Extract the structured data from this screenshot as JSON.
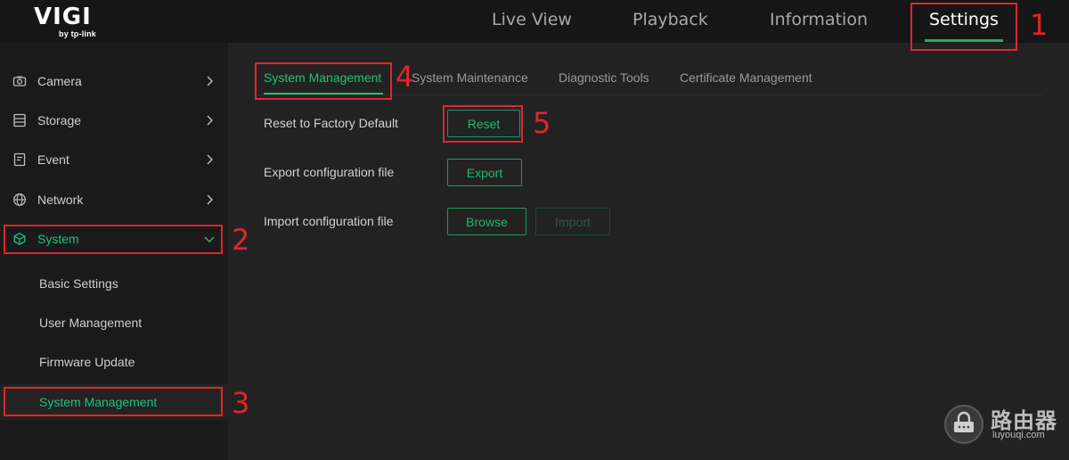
{
  "logo": {
    "main": "VIGI",
    "sub": "by tp-link"
  },
  "topnav": [
    {
      "label": "Live View"
    },
    {
      "label": "Playback"
    },
    {
      "label": "Information"
    },
    {
      "label": "Settings",
      "active": true
    }
  ],
  "sidebar": {
    "items": [
      {
        "label": "Camera",
        "icon": "camera-icon"
      },
      {
        "label": "Storage",
        "icon": "storage-icon"
      },
      {
        "label": "Event",
        "icon": "event-icon"
      },
      {
        "label": "Network",
        "icon": "globe-icon"
      },
      {
        "label": "System",
        "icon": "cube-icon",
        "active": true,
        "expanded": true
      }
    ],
    "subitems": [
      {
        "label": "Basic Settings"
      },
      {
        "label": "User Management"
      },
      {
        "label": "Firmware Update"
      },
      {
        "label": "System Management",
        "active": true
      }
    ]
  },
  "tabs": [
    {
      "label": "System Management",
      "active": true
    },
    {
      "label": "System Maintenance"
    },
    {
      "label": "Diagnostic Tools"
    },
    {
      "label": "Certificate Management"
    }
  ],
  "rows": [
    {
      "label": "Reset to Factory Default",
      "buttons": [
        "Reset"
      ]
    },
    {
      "label": "Export configuration file",
      "buttons": [
        "Export"
      ]
    },
    {
      "label": "Import configuration file",
      "buttons": [
        "Browse",
        "Import"
      ]
    }
  ],
  "annotations": [
    "1",
    "2",
    "3",
    "4",
    "5"
  ],
  "watermark": {
    "title": "路由器",
    "sub": "luyouqi.com"
  },
  "colors": {
    "accent": "#1fc27a",
    "annotation": "#e0262c",
    "background": "#1c1c1c"
  }
}
